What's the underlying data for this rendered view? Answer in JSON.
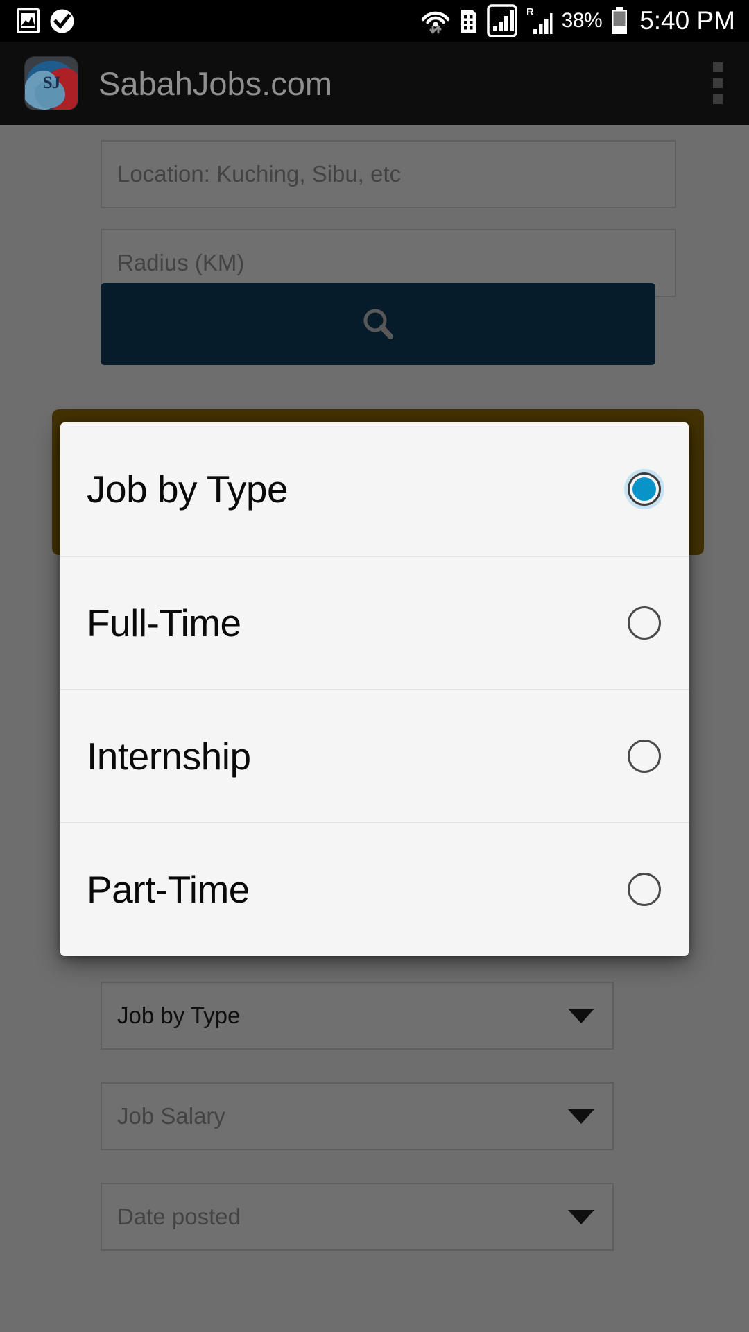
{
  "status_bar": {
    "icons_left": [
      "photo-icon",
      "check-circle-icon"
    ],
    "icons_right": [
      "wifi-icon",
      "sim-building-icon",
      "signal-boxed-icon",
      "roaming-signal-icon"
    ],
    "battery_percent": "38%",
    "battery_icon": "battery-icon",
    "time": "5:40 PM"
  },
  "app_bar": {
    "logo_text": "SJ",
    "logo_icon": "sabahjobs-logo-icon",
    "title": "SabahJobs.com",
    "overflow_icon": "overflow-menu-icon",
    "background": "#0d0d0d",
    "title_color": "#8f8f8f"
  },
  "search_form": {
    "location_placeholder": "Location: Kuching, Sibu, etc",
    "radius_placeholder": "Radius (KM)",
    "search_button": {
      "icon": "search-icon",
      "color": "#0f4061"
    },
    "accent_button_color": "#9a7308",
    "dropdowns": [
      {
        "value": "Job by Type",
        "is_placeholder": false,
        "caret_icon": "chevron-down-icon"
      },
      {
        "value": "Job Salary",
        "is_placeholder": true,
        "caret_icon": "chevron-down-icon"
      },
      {
        "value": "Date posted",
        "is_placeholder": true,
        "caret_icon": "chevron-down-icon"
      }
    ]
  },
  "dialog": {
    "selected_index": 0,
    "selected_color": "#0894c8",
    "options": [
      {
        "label": "Job by Type",
        "selected": true
      },
      {
        "label": "Full-Time",
        "selected": false
      },
      {
        "label": "Internship",
        "selected": false
      },
      {
        "label": "Part-Time",
        "selected": false
      }
    ]
  }
}
